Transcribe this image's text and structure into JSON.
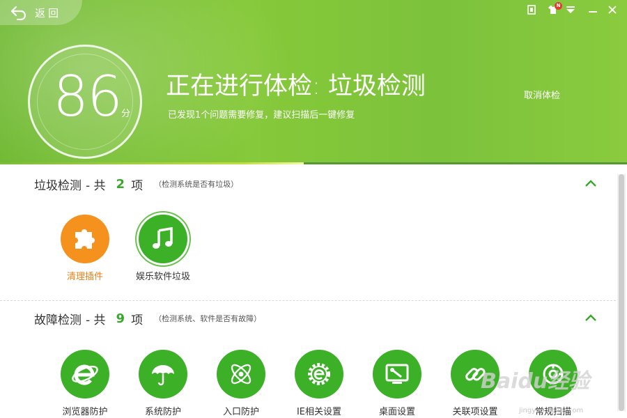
{
  "header": {
    "back_label": "返回",
    "score": "86",
    "score_unit": "分",
    "title": "正在进行体检: 垃圾检测",
    "subtitle": "已发现1个问题需要修复，建议扫描后一键修复",
    "cancel_label": "取消体检",
    "badge": "N",
    "progress": 0.484
  },
  "sections": [
    {
      "title": "垃圾检测",
      "count_prefix": "- 共",
      "count": "2",
      "count_suffix": "项",
      "hint": "（检测系统是否有垃圾）",
      "items": [
        {
          "label": "清理插件",
          "icon": "puzzle-icon",
          "color": "#f5921e"
        },
        {
          "label": "娱乐软件垃圾",
          "icon": "music-note-icon",
          "color": "#3cb027"
        }
      ]
    },
    {
      "title": "故障检测",
      "count_prefix": "- 共",
      "count": "9",
      "count_suffix": "项",
      "hint": "（检测系统、软件是否有故障）",
      "items": [
        {
          "label": "浏览器防护",
          "icon": "ie-icon",
          "color": "#3cb027"
        },
        {
          "label": "系统防护",
          "icon": "umbrella-icon",
          "color": "#3cb027"
        },
        {
          "label": "入口防护",
          "icon": "atom-icon",
          "color": "#3cb027"
        },
        {
          "label": "IE相关设置",
          "icon": "gear-e-icon",
          "color": "#3cb027"
        },
        {
          "label": "桌面设置",
          "icon": "monitor-wrench-icon",
          "color": "#3cb027"
        },
        {
          "label": "关联项设置",
          "icon": "link-icon",
          "color": "#3cb027"
        },
        {
          "label": "常规扫描",
          "icon": "scan-icon",
          "color": "#3cb027"
        }
      ]
    }
  ],
  "watermark": {
    "text": "Baidu经验",
    "url": "jingyan.baidu.com"
  },
  "colors": {
    "accent_green": "#3cb027",
    "orange": "#f5921e",
    "header_green": "#7cc23b"
  }
}
